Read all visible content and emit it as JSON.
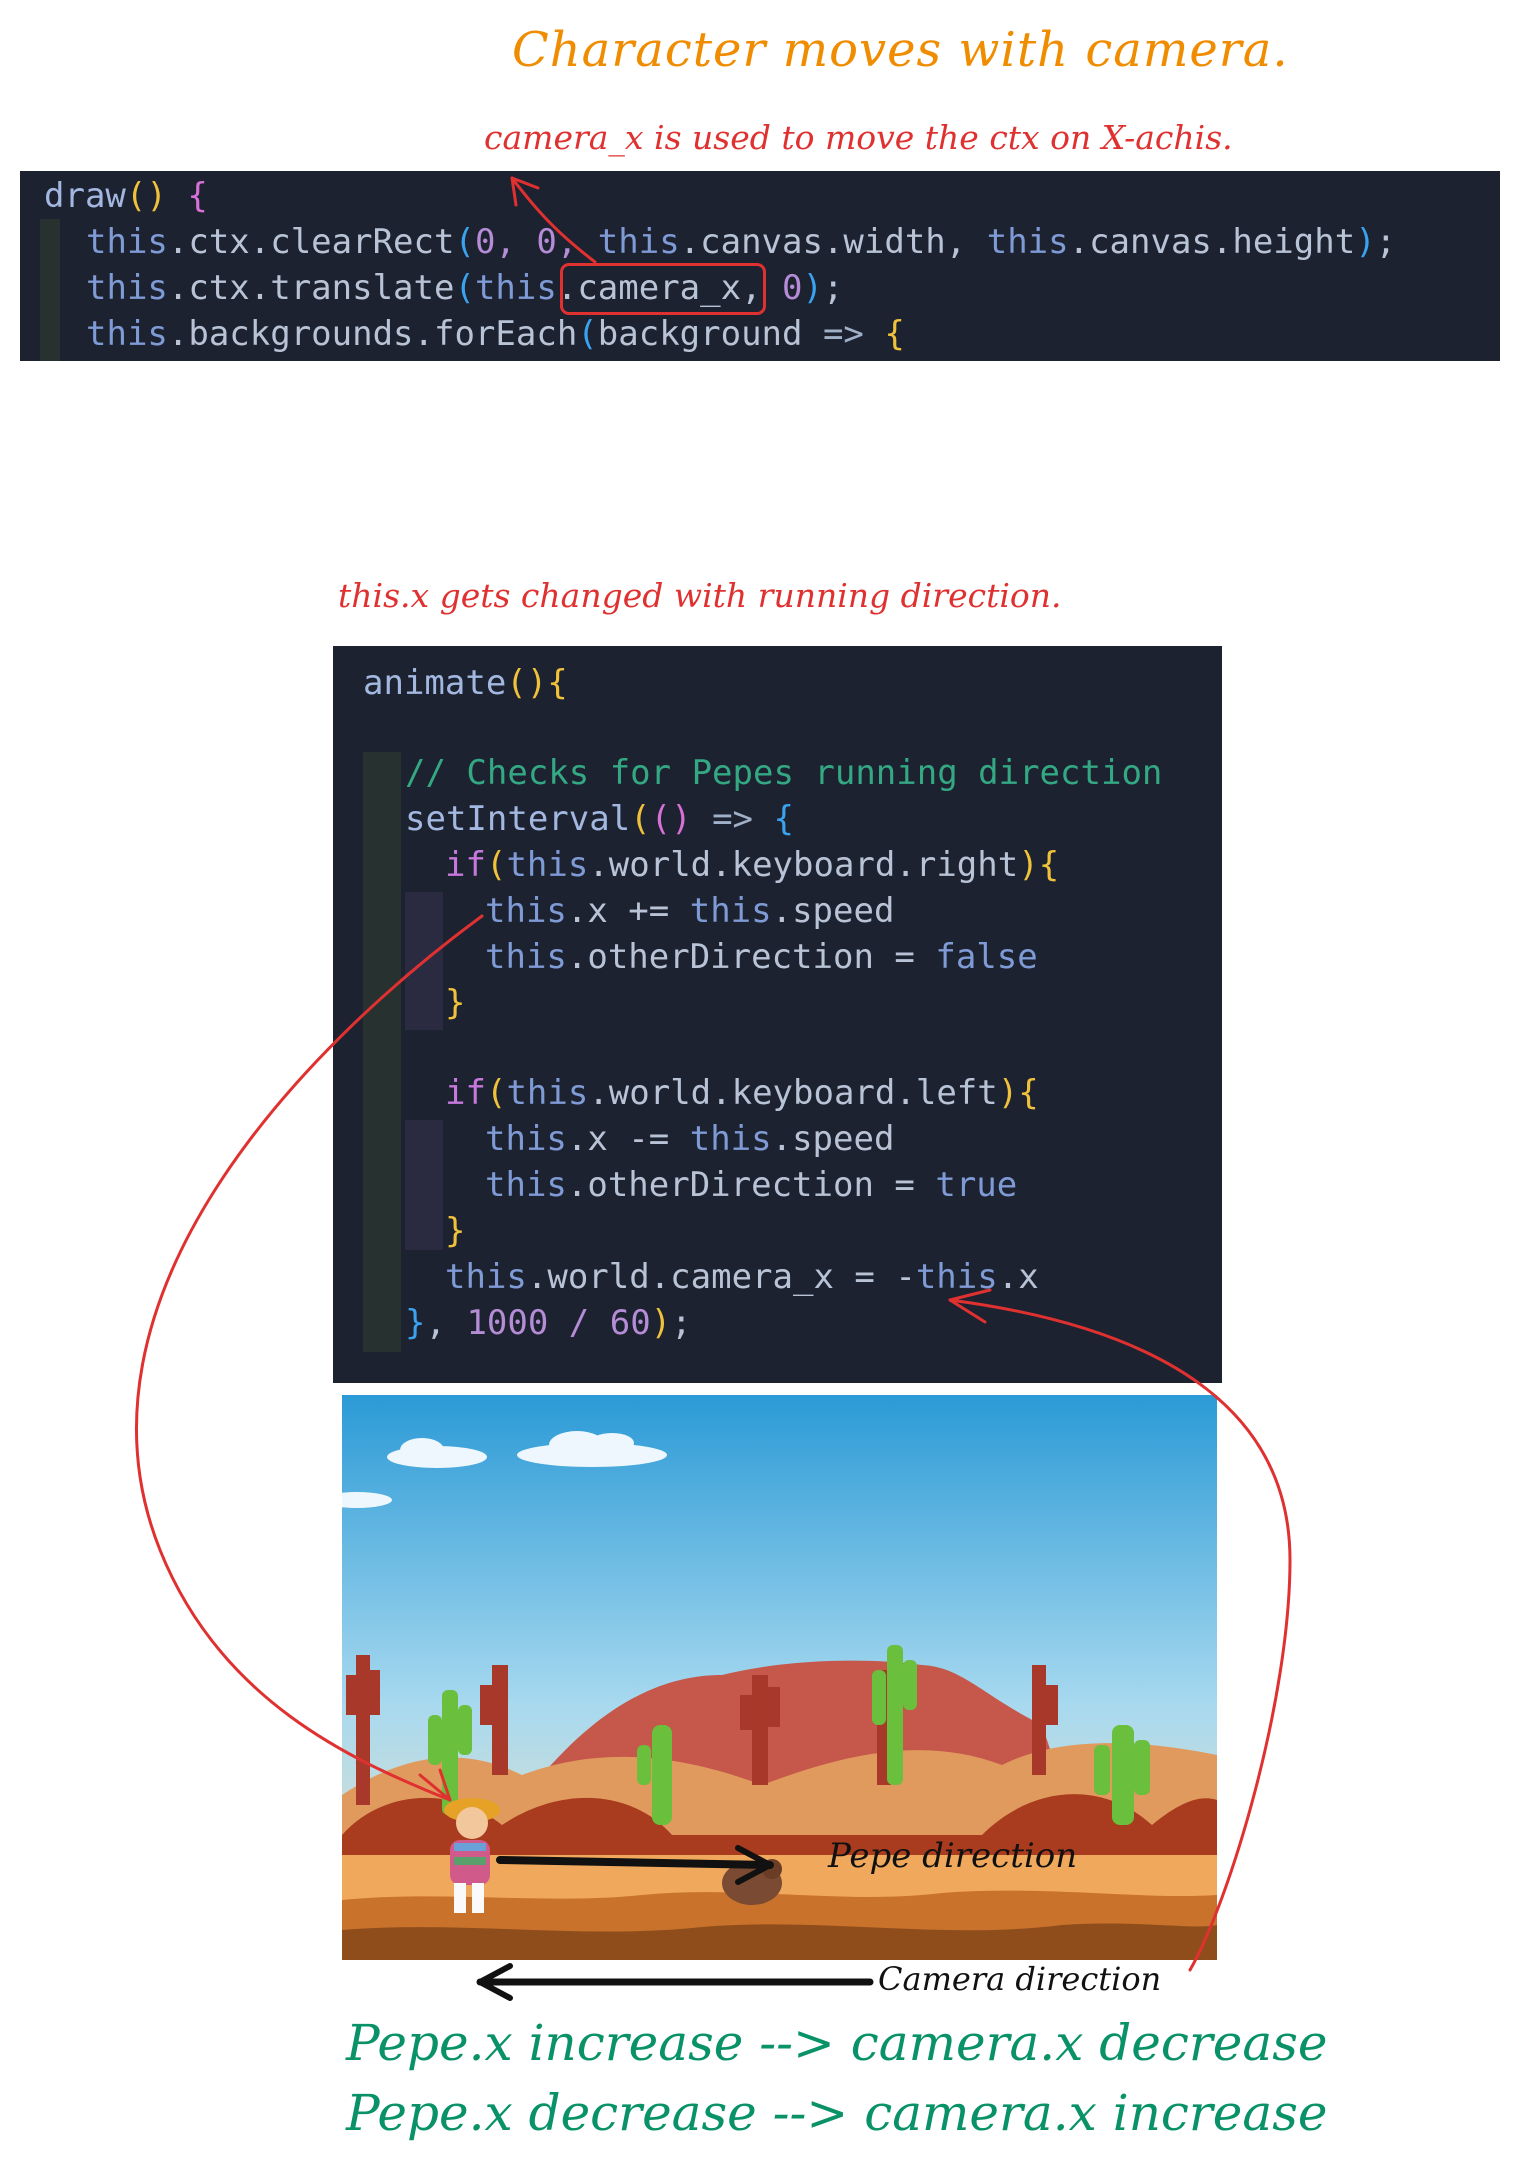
{
  "title": "Character moves with camera.",
  "annotations": {
    "camera_note": "camera_x is used to move the ctx on X-achis.",
    "this_x_note": "this.x gets changed with running direction.",
    "pepe_direction": "Pepe direction",
    "camera_direction": "Camera direction"
  },
  "summary": {
    "line1": "Pepe.x increase --> camera.x decrease",
    "line2": "Pepe.x decrease --> camera.x increase"
  },
  "code_draw": {
    "l1_fn": "draw",
    "l1_paren": "()",
    "l1_brace": "{",
    "l2_this": "this",
    "l2_rest": ".ctx.clearRect",
    "l2_open": "(",
    "l2_args_a": "0, 0, ",
    "l2_this2": "this",
    "l2_args_b": ".canvas.width, ",
    "l2_this3": "this",
    "l2_args_c": ".canvas.height",
    "l2_close": ")",
    "l2_semi": ";",
    "l3_this": "this",
    "l3_rest": ".ctx.translate",
    "l3_open": "(",
    "l3_this2": "this",
    "l3_dot": ".",
    "l3_var": "camera_x, ",
    "l3_num": "0",
    "l3_close": ")",
    "l3_semi": ";",
    "l4_this": "this",
    "l4_rest": ".backgrounds.forEach",
    "l4_open": "(",
    "l4_arg": "background ",
    "l4_arrow": "=> ",
    "l4_brace": "{"
  },
  "code_animate": {
    "l1_fn": "animate",
    "l1_paren": "()",
    "l1_brace": "{",
    "comment": "// Checks for Pepes running direction",
    "si_fn": "setInterval",
    "si_open": "(",
    "si_paren": "()",
    "si_arrow": " => ",
    "si_brace": "{",
    "if1_kw": "if",
    "if1_open": "(",
    "if1_this": "this",
    "if1_rest": ".world.keyboard.right",
    "if1_close": ")",
    "if1_brace": "{",
    "a1_this": "this",
    "a1_rest": ".x += ",
    "a1_this2": "this",
    "a1_rest2": ".speed",
    "b1_this": "this",
    "b1_rest": ".otherDirection = ",
    "b1_val": "false",
    "end1": "}",
    "if2_kw": "if",
    "if2_open": "(",
    "if2_this": "this",
    "if2_rest": ".world.keyboard.left",
    "if2_close": ")",
    "if2_brace": "{",
    "a2_this": "this",
    "a2_rest": ".x -= ",
    "a2_this2": "this",
    "a2_rest2": ".speed",
    "b2_this": "this",
    "b2_rest": ".otherDirection = ",
    "b2_val": "true",
    "end2": "}",
    "cam_this": "this",
    "cam_rest": ".world.camera_x = -",
    "cam_this2": "this",
    "cam_rest2": ".x",
    "close_brace": "}",
    "close_rest": ", ",
    "close_num": "1000 / 60",
    "close_paren": ")",
    "close_semi": ";"
  },
  "colors": {
    "title": "#f08c00",
    "note": "#e03131",
    "summary": "#099268",
    "code_bg": "#1d2230"
  }
}
